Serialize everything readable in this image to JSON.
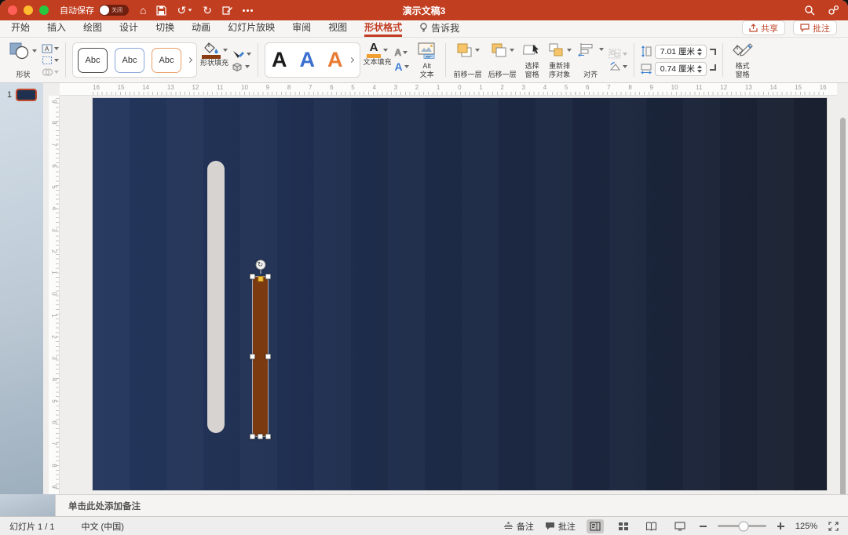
{
  "titlebar": {
    "autosave_label": "自动保存",
    "autosave_state": "关闭",
    "title": "演示文稿3"
  },
  "menu_tabs": {
    "items": [
      "开始",
      "插入",
      "绘图",
      "设计",
      "切换",
      "动画",
      "幻灯片放映",
      "审阅",
      "视图",
      "形状格式"
    ],
    "active": "形状格式",
    "tell_me": "告诉我"
  },
  "header_actions": {
    "share": "共享",
    "comments": "批注"
  },
  "ribbon": {
    "shapes_label": "形状",
    "style_presets": [
      {
        "label": "Abc",
        "border": "#4a4a4a"
      },
      {
        "label": "Abc",
        "border": "#8aa7d8"
      },
      {
        "label": "Abc",
        "border": "#e8a06a"
      }
    ],
    "shape_fill_label": "形状填充",
    "shape_fill_color": "#8a3c10",
    "wordart_presets": [
      {
        "label": "A",
        "color": "#1a1a1a"
      },
      {
        "label": "A",
        "color": "#3b6fd0"
      },
      {
        "label": "A",
        "color": "#e87a33"
      }
    ],
    "text_fill_label": "文本填充",
    "text_fill_bar_color": "#f0a030",
    "alt_text_label": "Alt\n文本",
    "bring_forward_label": "前移一层",
    "send_backward_label": "后移一层",
    "selection_pane_label": "选择\n窗格",
    "reorder_label": "重新排\n序对象",
    "align_label": "对齐",
    "height_value": "7.01 厘米",
    "width_value": "0.74 厘米",
    "format_pane_label": "格式\n窗格"
  },
  "slide_panel": {
    "slide_number": "1"
  },
  "rulers": {
    "horizontal": [
      "16",
      "15",
      "14",
      "13",
      "12",
      "11",
      "10",
      "9",
      "8",
      "7",
      "6",
      "5",
      "4",
      "3",
      "2",
      "1",
      "0",
      "1",
      "2",
      "3",
      "4",
      "5",
      "6",
      "7",
      "8",
      "9",
      "10",
      "11",
      "12",
      "13",
      "14",
      "15",
      "16"
    ],
    "vertical": [
      "9",
      "8",
      "7",
      "6",
      "5",
      "4",
      "3",
      "2",
      "1",
      "0",
      "1",
      "2",
      "3",
      "4",
      "5",
      "6",
      "7",
      "8",
      "9"
    ]
  },
  "slide": {
    "background_start": "#25375e",
    "background_end": "#1b2130",
    "shapes": [
      {
        "name": "rounded-pill",
        "fill": "#d6d3d0"
      },
      {
        "name": "selected-rounded-rect",
        "fill": "#7b3a10"
      }
    ]
  },
  "notes": {
    "placeholder": "单击此处添加备注"
  },
  "statusbar": {
    "slide_indicator": "幻灯片 1 / 1",
    "language": "中文 (中国)",
    "notes_label": "备注",
    "comments_label": "批注",
    "zoom_level": "125%"
  }
}
